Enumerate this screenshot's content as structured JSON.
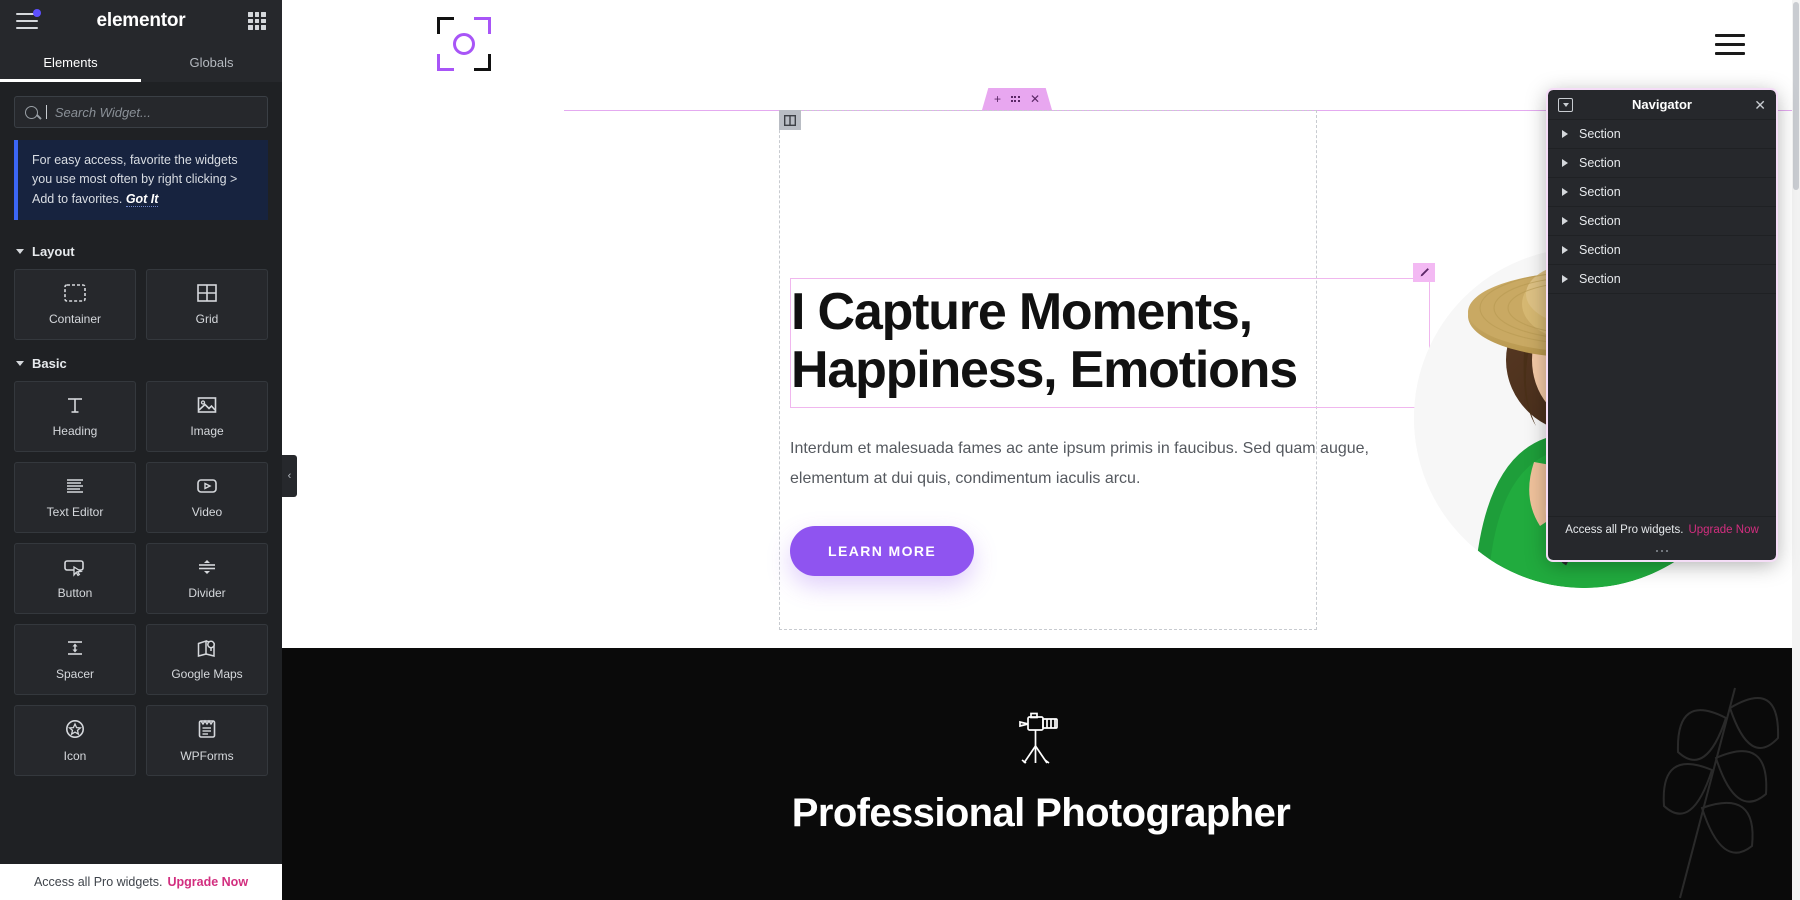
{
  "panel": {
    "brand": "elementor",
    "icons": {
      "menu": "hamburger-icon",
      "apps": "apps-grid-icon",
      "notification": "notification-dot"
    },
    "tabs": [
      {
        "label": "Elements",
        "active": true
      },
      {
        "label": "Globals",
        "active": false
      }
    ],
    "search": {
      "placeholder": "Search Widget...",
      "value": ""
    },
    "notice": {
      "text": "For easy access, favorite the widgets you use most often by right clicking > Add to favorites. ",
      "cta": "Got It"
    },
    "categories": [
      {
        "title": "Layout",
        "widgets": [
          {
            "label": "Container",
            "icon": "container-icon"
          },
          {
            "label": "Grid",
            "icon": "grid-icon"
          }
        ]
      },
      {
        "title": "Basic",
        "widgets": [
          {
            "label": "Heading",
            "icon": "heading-t-icon"
          },
          {
            "label": "Image",
            "icon": "image-icon"
          },
          {
            "label": "Text Editor",
            "icon": "text-editor-icon"
          },
          {
            "label": "Video",
            "icon": "video-play-icon"
          },
          {
            "label": "Button",
            "icon": "button-cursor-icon"
          },
          {
            "label": "Divider",
            "icon": "divider-icon"
          },
          {
            "label": "Spacer",
            "icon": "spacer-icon"
          },
          {
            "label": "Google Maps",
            "icon": "google-maps-icon"
          },
          {
            "label": "Icon",
            "icon": "star-circle-icon"
          },
          {
            "label": "WPForms",
            "icon": "wpforms-icon"
          }
        ]
      }
    ],
    "footer": {
      "text": "Access all Pro widgets.",
      "cta": "Upgrade Now"
    },
    "collapse": "‹"
  },
  "section_toolbar": {
    "add": "+",
    "drag": "drag-dots-icon",
    "close": "✕"
  },
  "site": {
    "logo": "camera-bracket-logo",
    "menu": "nav-hamburger-icon",
    "hero": {
      "heading": "I Capture Moments, Happiness, Emotions",
      "paragraph": "Interdum et malesuada fames ac ante ipsum primis in faucibus. Sed quam augue, elementum at dui quis, condimentum iaculis arcu.",
      "button": "LEARN MORE",
      "photo_alt": "smiling-woman-with-camera-photo"
    },
    "dark_section": {
      "icon": "tripod-camera-icon",
      "title": "Professional Photographer"
    }
  },
  "navigator": {
    "title": "Navigator",
    "dock_icon": "dock-toggle-icon",
    "close_icon": "✕",
    "rows": [
      {
        "label": "Section"
      },
      {
        "label": "Section"
      },
      {
        "label": "Section"
      },
      {
        "label": "Section"
      },
      {
        "label": "Section"
      },
      {
        "label": "Section"
      }
    ],
    "footer": {
      "text": "Access all Pro widgets.",
      "cta": "Upgrade Now"
    }
  },
  "colors": {
    "accent_purple": "#8f54f0",
    "pink_handle": "#e8a7f0",
    "upgrade_pink": "#d22e7f",
    "panel_bg": "#1f2124",
    "notice_blue": "#3b66f5"
  }
}
